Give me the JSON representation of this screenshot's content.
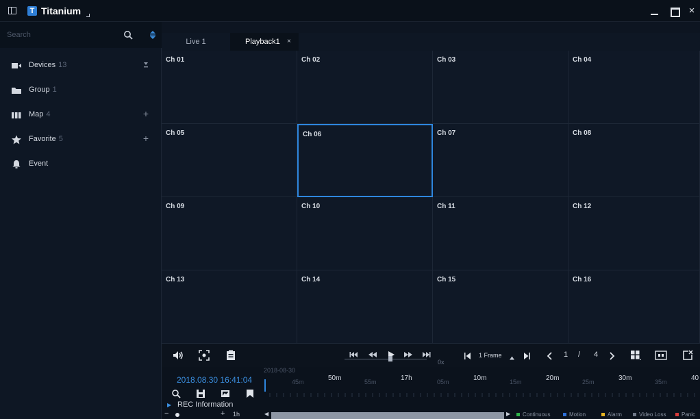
{
  "titlebar": {
    "app_name": "Titanium",
    "logo_letter": "T",
    "min_label": "",
    "max_label": "",
    "close_label": "×"
  },
  "sidebar": {
    "search_placeholder": "Search",
    "items": [
      {
        "label": "Devices",
        "count": "13",
        "action": "download"
      },
      {
        "label": "Group",
        "count": "1",
        "action": ""
      },
      {
        "label": "Map",
        "count": "4",
        "action": "+"
      },
      {
        "label": "Favorite",
        "count": "5",
        "action": "+"
      },
      {
        "label": "Event",
        "count": "",
        "action": ""
      }
    ]
  },
  "tabs": [
    {
      "label": "Live 1"
    },
    {
      "label": "Playback1",
      "close": "×"
    }
  ],
  "grid": {
    "channels": [
      "Ch 01",
      "Ch 02",
      "Ch 03",
      "Ch 04",
      "Ch 05",
      "Ch 06",
      "Ch 07",
      "Ch 08",
      "Ch 09",
      "Ch 10",
      "Ch 11",
      "Ch 12",
      "Ch 13",
      "Ch 14",
      "Ch 15",
      "Ch 16"
    ],
    "selected": "Ch 06"
  },
  "controls": {
    "speed_label": "0x",
    "frame_label": "1 Frame",
    "page_current": "1",
    "page_sep": "/",
    "page_total": "4"
  },
  "timeline": {
    "datetime": "2018.08.30 16:41:04",
    "date_top": "2018-08-30",
    "rec_info": "REC Information",
    "ticks": [
      {
        "label": "45m",
        "major": false
      },
      {
        "label": "50m",
        "major": true
      },
      {
        "label": "55m",
        "major": false
      },
      {
        "label": "17h",
        "major": true
      },
      {
        "label": "05m",
        "major": false
      },
      {
        "label": "10m",
        "major": true
      },
      {
        "label": "15m",
        "major": false
      },
      {
        "label": "20m",
        "major": true
      },
      {
        "label": "25m",
        "major": false
      },
      {
        "label": "30m",
        "major": true
      },
      {
        "label": "35m",
        "major": false
      },
      {
        "label": "40",
        "major": true
      }
    ]
  },
  "bottom": {
    "zoom_minus": "−",
    "zoom_plus": "+",
    "zoom_level": "1h",
    "legend": [
      {
        "label": "Continuous",
        "color": "#2fb34a"
      },
      {
        "label": "Motion",
        "color": "#2e6fd6"
      },
      {
        "label": "Alarm",
        "color": "#e6b422"
      },
      {
        "label": "Video Loss",
        "color": "#6e7787"
      },
      {
        "label": "Panic",
        "color": "#d63a3a"
      }
    ]
  },
  "colors": {
    "accent": "#2e86de",
    "background": "#0d1521"
  }
}
